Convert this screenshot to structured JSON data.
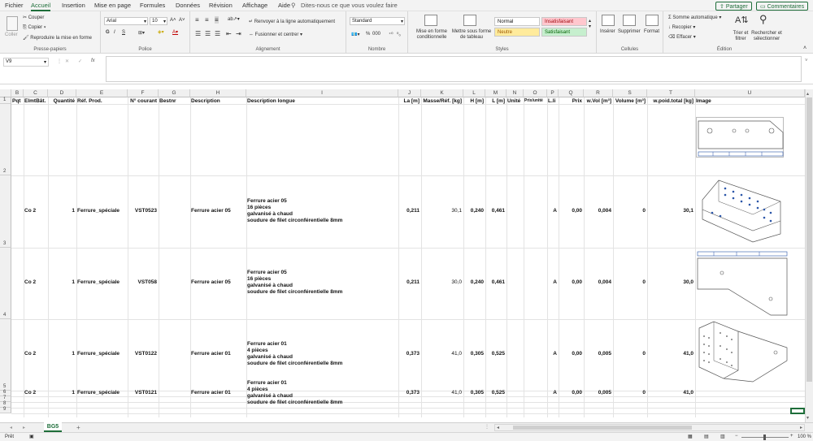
{
  "menu": {
    "tabs": [
      "Fichier",
      "Accueil",
      "Insertion",
      "Mise en page",
      "Formules",
      "Données",
      "Révision",
      "Affichage",
      "Aide"
    ],
    "search_placeholder": "Dites-nous ce que vous voulez faire",
    "share": "Partager",
    "comments": "Commentaires"
  },
  "ribbon": {
    "clipboard": {
      "paste": "Coller",
      "cut": "Couper",
      "copy": "Copier",
      "format_painter": "Reproduire la mise en forme",
      "label": "Presse-papiers"
    },
    "font": {
      "name": "Arial",
      "size": "10",
      "bold": "G",
      "italic": "I",
      "underline": "S",
      "label": "Police"
    },
    "alignment": {
      "wrap": "Renvoyer à la ligne automatiquement",
      "merge": "Fusionner et centrer",
      "label": "Alignement"
    },
    "number": {
      "format": "Standard",
      "percent": "%",
      "thousands": "000",
      "label": "Nombre"
    },
    "styles": {
      "conditional": "Mise en forme conditionnelle",
      "table": "Mettre sous forme de tableau",
      "normal": "Normal",
      "bad": "Insatisfaisant",
      "neutral": "Neutre",
      "good": "Satisfaisant",
      "label": "Styles"
    },
    "cells": {
      "insert": "Insérer",
      "delete": "Supprimer",
      "format": "Format",
      "label": "Cellules"
    },
    "editing": {
      "autosum": "Somme automatique",
      "fill": "Recopier",
      "clear": "Effacer",
      "sort": "Trier et filtrer",
      "find": "Rechercher et sélectionner",
      "label": "Édition"
    },
    "colors": {
      "good_bg": "#c6efce",
      "good_fg": "#006100",
      "bad_bg": "#ffc7ce",
      "bad_fg": "#9c0006",
      "neutral_bg": "#ffeb9c",
      "neutral_fg": "#9c5700",
      "accent": "#1e6e3a"
    }
  },
  "formula_bar": {
    "name_box": "V9",
    "fx": "fx",
    "value": ""
  },
  "grid": {
    "columns": [
      "B",
      "C",
      "D",
      "E",
      "F",
      "G",
      "H",
      "I",
      "J",
      "K",
      "L",
      "M",
      "N",
      "O",
      "P",
      "Q",
      "R",
      "S",
      "T",
      "U"
    ],
    "header_row": [
      "Pqt",
      "ElmtBât.",
      "Quantité",
      "Réf. Prod.",
      "N° courant",
      "Bestnr",
      "Description",
      "Description longue",
      "La [m]",
      "Masse/Réf. [kg]",
      "H [m]",
      "L [m]",
      "Unité",
      "Prix/unité",
      "L.li",
      "Prix",
      "w.Vol [m³]",
      "Volume [m³]",
      "w.poid.total [kg]",
      "Image"
    ],
    "row_numbers": [
      "1",
      "2",
      "3",
      "4",
      "5",
      "6",
      "7",
      "8",
      "9"
    ],
    "rows": [
      {
        "elmt": "Co 2",
        "qty": "1",
        "ref": "Ferrure_spéciale",
        "num": "VST0523",
        "desc": "Ferrure acier 05",
        "long": [
          "Ferrure acier 05",
          "16 pièces",
          "galvanisé à chaud",
          "soudure de filet circonférentielle 8mm"
        ],
        "la": "0,211",
        "masse": "30,1",
        "h": "0,240",
        "l": "0,461",
        "lli": "A",
        "prix": "0,00",
        "wvol": "0,004",
        "vol": "0",
        "wpoid": "30,1"
      },
      {
        "elmt": "Co 2",
        "qty": "1",
        "ref": "Ferrure_spéciale",
        "num": "VST058",
        "desc": "Ferrure acier 05",
        "long": [
          "Ferrure acier 05",
          "16 pièces",
          "galvanisé à chaud",
          "soudure de filet circonférentielle 8mm"
        ],
        "la": "0,211",
        "masse": "30,0",
        "h": "0,240",
        "l": "0,461",
        "lli": "A",
        "prix": "0,00",
        "wvol": "0,004",
        "vol": "0",
        "wpoid": "30,0"
      },
      {
        "elmt": "Co 2",
        "qty": "1",
        "ref": "Ferrure_spéciale",
        "num": "VST0122",
        "desc": "Ferrure acier 01",
        "long": [
          "Ferrure acier 01",
          "4 pièces",
          "galvanisé à chaud",
          "soudure de filet circonférentielle 8mm"
        ],
        "la": "0,373",
        "masse": "41,0",
        "h": "0,305",
        "l": "0,525",
        "lli": "A",
        "prix": "0,00",
        "wvol": "0,005",
        "vol": "0",
        "wpoid": "41,0"
      },
      {
        "elmt": "Co 2",
        "qty": "1",
        "ref": "Ferrure_spéciale",
        "num": "VST0121",
        "desc": "Ferrure acier 01",
        "long": [
          "Ferrure acier 01",
          "4 pièces",
          "galvanisé à chaud",
          "soudure de filet circonférentielle 8mm"
        ],
        "la": "0,373",
        "masse": "41,0",
        "h": "0,305",
        "l": "0,525",
        "lli": "A",
        "prix": "0,00",
        "wvol": "0,005",
        "vol": "0",
        "wpoid": "41,0"
      }
    ]
  },
  "sheet_tabs": {
    "active": "BG5",
    "add": "+"
  },
  "status": {
    "ready": "Prêt",
    "zoom": "100 %"
  }
}
